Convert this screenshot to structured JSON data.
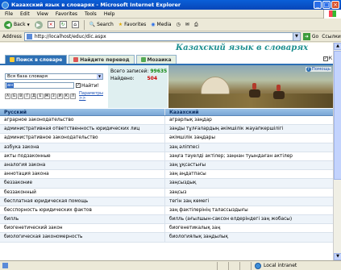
{
  "window": {
    "title": "Казахский язык в словарях - Microsoft Internet Explorer"
  },
  "menu": [
    "File",
    "Edit",
    "View",
    "Favorites",
    "Tools",
    "Help"
  ],
  "toolbar": {
    "back": "Back",
    "search": "Search",
    "favorites": "Favorites",
    "media": "Media"
  },
  "address": {
    "label": "Address",
    "url": "http://localhost/educ/dic.aspx",
    "go": "Go",
    "links": "Ссылки"
  },
  "site": {
    "logo": "Казахский язык в словарях",
    "tabs": [
      "Поиск в словаре",
      "Найдите перевод",
      "Мозаика"
    ],
    "top_check_label": "К"
  },
  "search": {
    "dictionary": "Вся база словаря",
    "query": "ан",
    "find_label": "Найти!",
    "alphabet": [
      "А",
      "Б",
      "В",
      "Г",
      "Д",
      "Е",
      "Ж",
      "З",
      "И",
      "К",
      "Л"
    ],
    "params_link": "Параметры >>"
  },
  "stats": {
    "total_label": "Всего записей:",
    "total_value": "99635",
    "found_label": "Найдено:",
    "found_value": "504"
  },
  "help": {
    "label": "Помощь"
  },
  "results": {
    "headers": [
      "Русский",
      "Казахский"
    ],
    "rows": [
      [
        "аграрное законодательство",
        "аграрлық заңдар"
      ],
      [
        "административная ответственность юридических лиц",
        "заңды тұлғалардың әкімшілік жауапкершілігі"
      ],
      [
        "административное законодательство",
        "әкімшілік заңдары"
      ],
      [
        "азбука закона",
        "заң әліппесі"
      ],
      [
        "акты подзаконные",
        "заңға тәуелді актілер; заңнан туындаған актілер"
      ],
      [
        "аналогия закона",
        "заң ұқсастығы"
      ],
      [
        "аннотация закона",
        "заң аңдатпасы"
      ],
      [
        "беззаконие",
        "заңсыздық"
      ],
      [
        "беззаконный",
        "заңсыз"
      ],
      [
        "бесплатная юридическая помощь",
        "тегін заң көмегі"
      ],
      [
        "бесспорность юридических фактов",
        "заң фактілерінің талассыздығы"
      ],
      [
        "билль",
        "билль (ағылшын-саксон елдеріндегі заң жобасы)"
      ],
      [
        "биогенетический закон",
        "биогенетикалық заң"
      ],
      [
        "биологическая закономерность",
        "биологиялық заңдылық"
      ]
    ]
  },
  "status": {
    "zone": "Local intranet"
  }
}
